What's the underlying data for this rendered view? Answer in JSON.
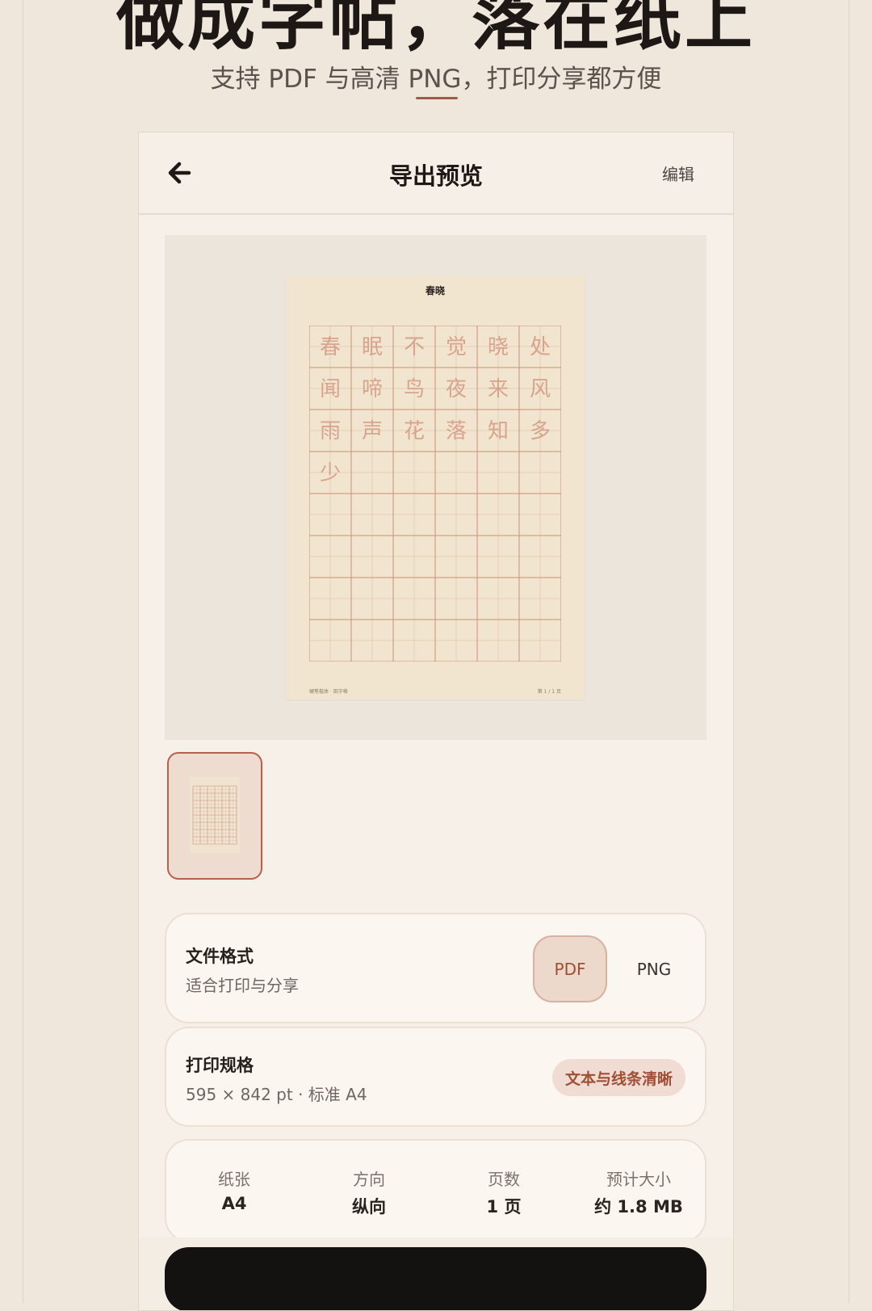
{
  "hero": {
    "title": "做成字帖，落在纸上",
    "subtitle": "支持 PDF 与高清 PNG，打印分享都方便"
  },
  "header": {
    "title": "导出预览",
    "edit_label": "编辑"
  },
  "preview": {
    "page_title": "春晓",
    "practice_chars": [
      "春",
      "眠",
      "不",
      "觉",
      "晓",
      "处",
      "闻",
      "啼",
      "鸟",
      "夜",
      "来",
      "风",
      "雨",
      "声",
      "花",
      "落",
      "知",
      "多",
      "少"
    ],
    "footer_left": "硬笔楷体 · 田字格",
    "footer_right": "第 1 / 1 页"
  },
  "format_card": {
    "title": "文件格式",
    "desc": "适合打印与分享",
    "options": [
      "PDF",
      "PNG"
    ],
    "selected": "PDF"
  },
  "spec_card": {
    "title": "打印规格",
    "desc": "595 × 842 pt · 标准 A4",
    "badge": "文本与线条清晰"
  },
  "stats": [
    {
      "label": "纸张",
      "value": "A4"
    },
    {
      "label": "方向",
      "value": "纵向"
    },
    {
      "label": "页数",
      "value": "1 页"
    },
    {
      "label": "预计大小",
      "value": "约 1.8 MB"
    }
  ],
  "colors": {
    "accent": "#a05c43",
    "background": "#efe7dc",
    "grid_line": "#c98f78",
    "trace_char": "#d7a48f"
  },
  "icons": {
    "back": "arrow-left-icon"
  }
}
